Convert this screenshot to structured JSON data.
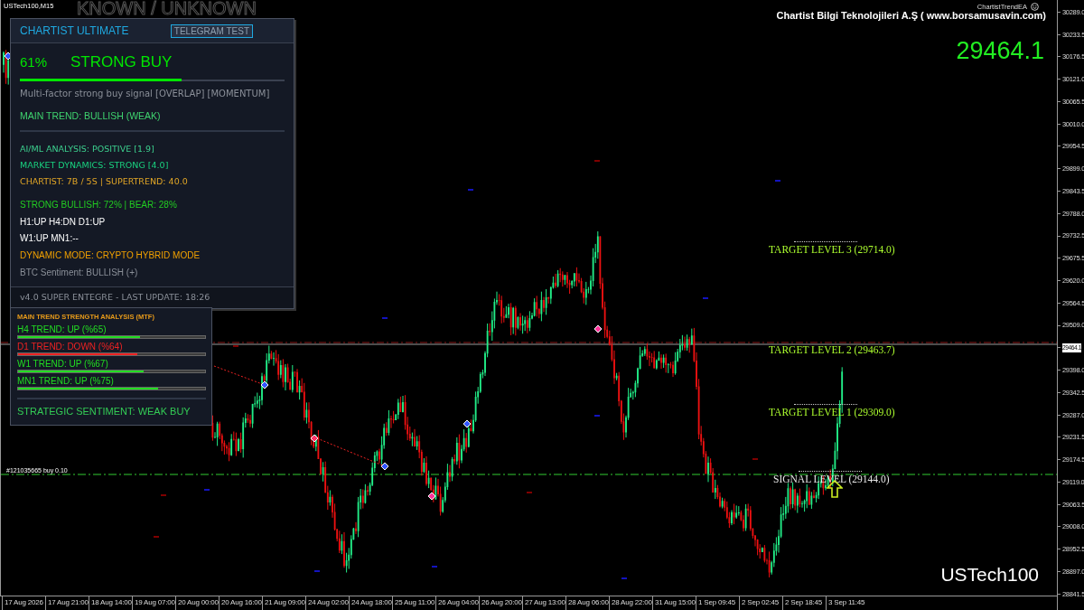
{
  "chart_header": {
    "symbol": "USTech100,M15",
    "background_label": "KNOWN / UNKNOWN",
    "expert": "ChartistTrendEA",
    "company": "Chartist Bilgi Teknolojileri A.Ş ( www.borsamusavin.com)",
    "big_price": "29464.1",
    "symbol_label": "USTech100"
  },
  "signal_panel": {
    "title": "CHARTIST ULTIMATE",
    "button": "TELEGRAM TEST",
    "percent": "61%",
    "signal": "STRONG BUY",
    "level": 0.61,
    "description": "Multi-factor strong buy signal [OVERLAP] [MOMENTUM]",
    "main_trend": "MAIN TREND: BULLISH (WEAK)",
    "analysis": [
      {
        "text": "AI/ML ANALYSIS: POSITIVE [1.9]",
        "color": "#3ccf8e"
      },
      {
        "text": "MARKET DYNAMICS: STRONG [4.0]",
        "color": "#19d17f"
      },
      {
        "text": "CHARTIST: 7B / 5S | SUPERTREND: 40.0",
        "color": "#e0a526"
      }
    ],
    "status": [
      {
        "text": "STRONG BULLISH: 72% | BEAR: 28%",
        "color": "#22cc22"
      },
      {
        "text": "H1:UP H4:DN D1:UP",
        "color": "#ffffff"
      },
      {
        "text": "W1:UP MN1:--",
        "color": "#ffffff"
      },
      {
        "text": "DYNAMIC MODE: CRYPTO HYBRID MODE",
        "color": "#f0a000"
      },
      {
        "text": "BTC Sentiment: BULLISH (+)",
        "color": "#8a8f98"
      }
    ],
    "footer": "v4.0 SUPER ENTEGRE - LAST UPDATE: 18:26"
  },
  "trend_panel": {
    "title": "MAIN TREND STRENGTH ANALYSIS (MTF)",
    "trends": [
      {
        "label": "H4 TREND: UP (%65)",
        "color": "#22dd22",
        "level": 0.65
      },
      {
        "label": "D1 TREND: DOWN (%64)",
        "color": "#ee2222",
        "level": 0.64
      },
      {
        "label": "W1 TREND: UP (%67)",
        "color": "#22dd22",
        "level": 0.67
      },
      {
        "label": "MN1 TREND: UP (%75)",
        "color": "#22dd22",
        "level": 0.75
      }
    ],
    "sentiment": "STRATEGIC SENTIMENT: WEAK BUY"
  },
  "levels": [
    {
      "label": "TARGET LEVEL 3 (29714.0)",
      "kind": "target"
    },
    {
      "label": "TARGET LEVEL 2 (29463.7)",
      "kind": "target"
    },
    {
      "label": "TARGET LEVEL 1 (29309.0)",
      "kind": "target"
    },
    {
      "label": "SIGNAL LEVEL (29144.0)",
      "kind": "signal"
    }
  ],
  "trade": {
    "label": "#121035665 buy 0.10"
  },
  "price_axis": [
    {
      "text": "30289.0",
      "kind": "tick"
    },
    {
      "text": "30233.5",
      "kind": "tick"
    },
    {
      "text": "30176.5",
      "kind": "tick"
    },
    {
      "text": "30121.0",
      "kind": "tick"
    },
    {
      "text": "30065.5",
      "kind": "tick"
    },
    {
      "text": "30010.0",
      "kind": "tick"
    },
    {
      "text": "29954.5",
      "kind": "tick"
    },
    {
      "text": "29899.0",
      "kind": "tick"
    },
    {
      "text": "29843.5",
      "kind": "tick"
    },
    {
      "text": "29788.0",
      "kind": "tick"
    },
    {
      "text": "29732.5",
      "kind": "tick"
    },
    {
      "text": "29675.5",
      "kind": "tick"
    },
    {
      "text": "29620.0",
      "kind": "tick"
    },
    {
      "text": "29564.5",
      "kind": "tick"
    },
    {
      "text": "29509.0",
      "kind": "tick"
    },
    {
      "text": "29464.1",
      "kind": "current"
    },
    {
      "text": "29398.0",
      "kind": "tick"
    },
    {
      "text": "29342.5",
      "kind": "tick"
    },
    {
      "text": "29287.0",
      "kind": "tick"
    },
    {
      "text": "29231.5",
      "kind": "tick"
    },
    {
      "text": "29174.5",
      "kind": "tick"
    },
    {
      "text": "29119.0",
      "kind": "tick"
    },
    {
      "text": "29063.5",
      "kind": "tick"
    },
    {
      "text": "29008.0",
      "kind": "tick"
    },
    {
      "text": "28952.5",
      "kind": "tick"
    },
    {
      "text": "28897.0",
      "kind": "tick"
    },
    {
      "text": "28841.5",
      "kind": "tick"
    }
  ],
  "time_axis": [
    "17 Aug 2026",
    "17 Aug 21:00",
    "18 Aug 14:00",
    "19 Aug 07:00",
    "20 Aug 00:00",
    "20 Aug 16:00",
    "21 Aug 09:00",
    "24 Aug 02:00",
    "24 Aug 18:00",
    "25 Aug 11:00",
    "26 Aug 04:00",
    "26 Aug 20:00",
    "27 Aug 13:00",
    "28 Aug 06:00",
    "28 Aug 22:00",
    "31 Aug 15:00",
    "1 Sep 09:45",
    "2 Sep 02:45",
    "2 Sep 18:45",
    "3 Sep 11:45"
  ]
}
